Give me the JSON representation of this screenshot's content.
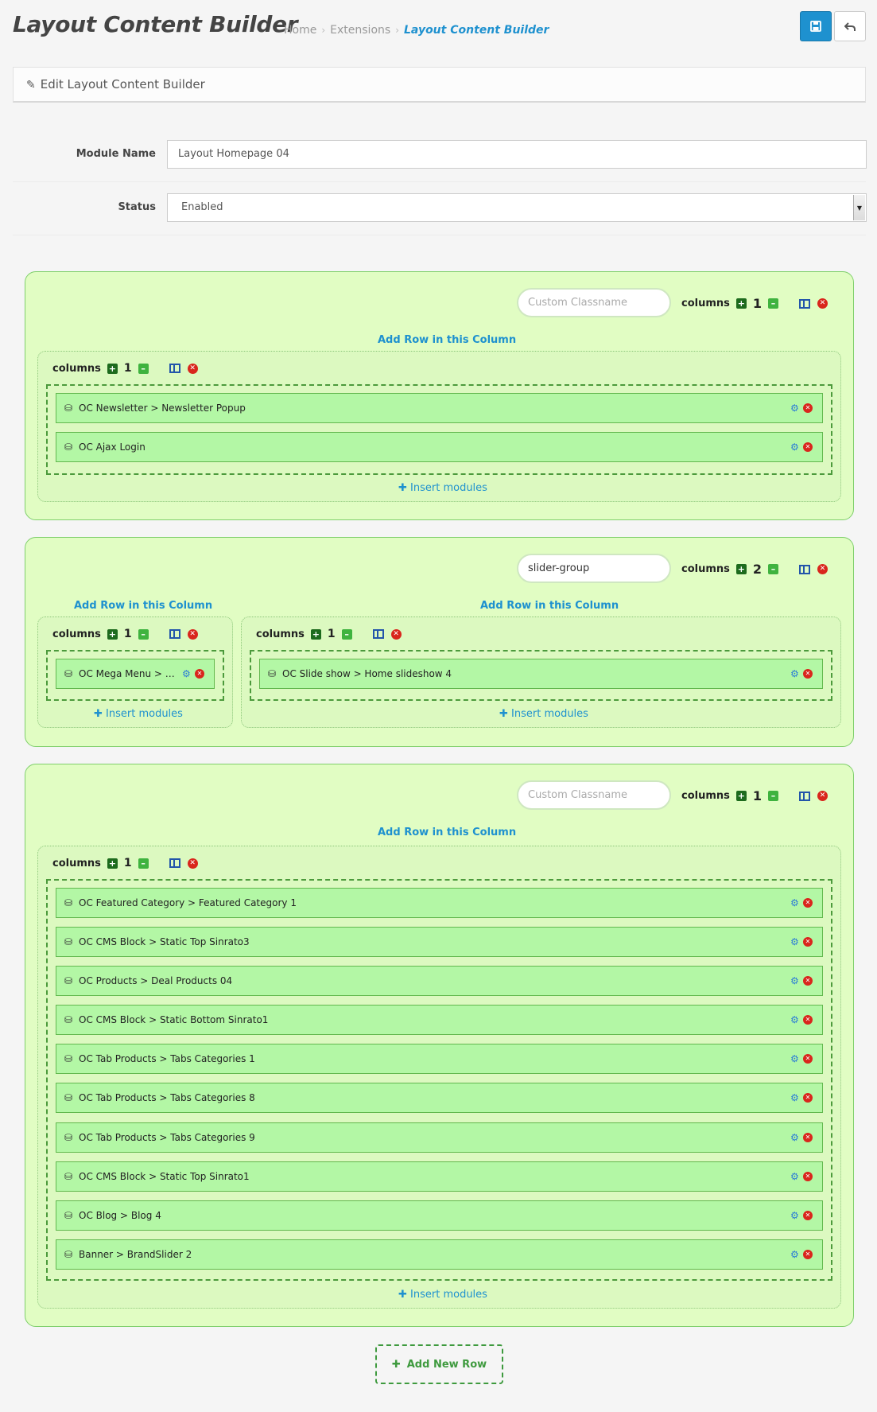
{
  "header": {
    "title": "Layout Content Builder",
    "breadcrumb": [
      "Home",
      "Extensions",
      "Layout Content Builder"
    ]
  },
  "panel": {
    "heading": "Edit Layout Content Builder"
  },
  "form": {
    "module_name_label": "Module Name",
    "module_name_value": "Layout Homepage 04",
    "status_label": "Status",
    "status_value": "Enabled"
  },
  "labels": {
    "columns": "columns",
    "add_row": "Add Row in this Column",
    "insert_modules": "Insert modules",
    "add_new_row": "Add New Row",
    "classname_placeholder": "Custom Classname"
  },
  "rows": [
    {
      "classname": "",
      "columns": 1,
      "cols": [
        {
          "columns": 1,
          "modules": [
            "OC Newsletter > Newsletter Popup",
            "OC Ajax Login"
          ]
        }
      ]
    },
    {
      "classname": "slider-group",
      "columns": 2,
      "cols": [
        {
          "columns": 1,
          "modules": [
            "OC Mega Menu > Ve..."
          ]
        },
        {
          "columns": 1,
          "modules": [
            "OC Slide show > Home slideshow 4"
          ]
        }
      ]
    },
    {
      "classname": "",
      "columns": 1,
      "cols": [
        {
          "columns": 1,
          "modules": [
            "OC Featured Category > Featured Category 1",
            "OC CMS Block > Static Top Sinrato3",
            "OC Products > Deal Products 04",
            "OC CMS Block > Static Bottom Sinrato1",
            "OC Tab Products > Tabs Categories 1",
            "OC Tab Products > Tabs Categories 8",
            "OC Tab Products > Tabs Categories 9",
            "OC CMS Block > Static Top Sinrato1",
            "OC Blog > Blog 4",
            "Banner > BrandSlider 2"
          ]
        }
      ]
    }
  ],
  "colors": {
    "accent": "#1e91cf",
    "row_bg": "#e1fdc3",
    "module_bg": "#b3f7a5",
    "danger": "#d9261c"
  }
}
